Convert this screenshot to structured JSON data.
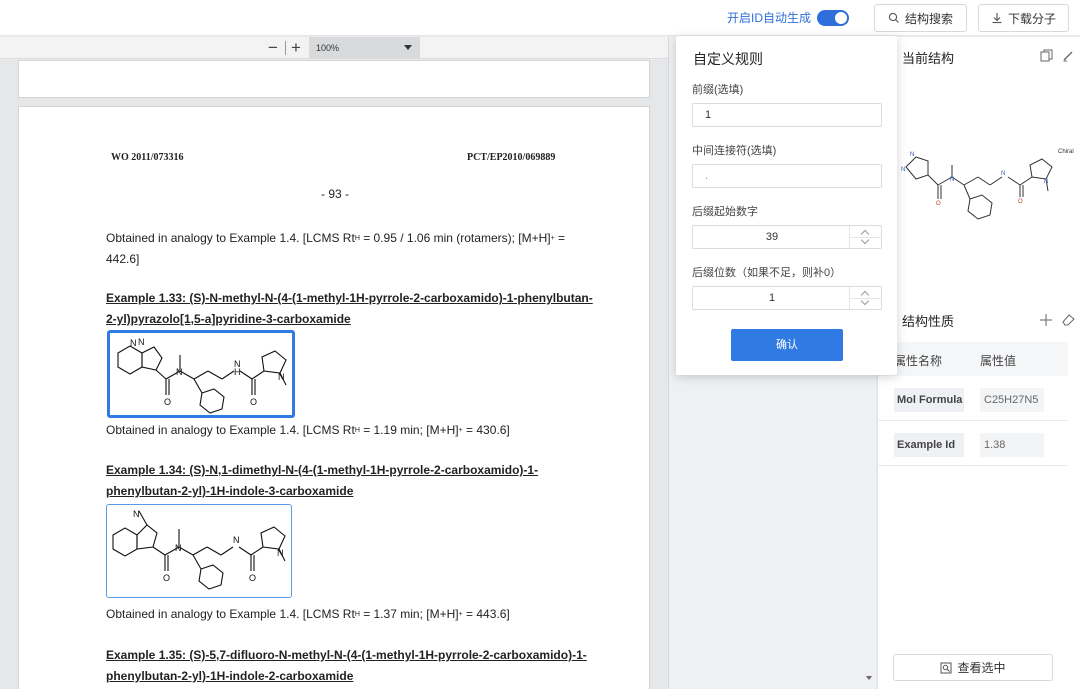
{
  "topbar": {
    "toggle_label": "开启ID自动生成",
    "toggle_on": true,
    "search_button": "结构搜索",
    "download_button": "下载分子"
  },
  "viewer": {
    "zoom_out": "−",
    "zoom_in": "+",
    "zoom_level": "100%",
    "page": {
      "header_left": "WO 2011/073316",
      "header_right": "PCT/EP2010/069889",
      "page_number": "- 93 -",
      "intro_text_1": "Obtained in analogy to Example 1.4. [LCMS Rt",
      "intro_sub": "H",
      "intro_text_2": " = 0.95 / 1.06 min (rotamers); [M+H]",
      "intro_sup": "+",
      "intro_text_3": " = 442.6]",
      "examples": [
        {
          "title": "Example 1.33: (S)-N-methyl-N-(4-(1-methyl-1H-pyrrole-2-carboxamido)-1-phenylbutan-2-yl)pyrazolo[1,5-a]pyridine-3-carboxamide",
          "result_1": "Obtained in analogy to Example 1.4. [LCMS Rt",
          "result_sub": "H",
          "result_2": " = 1.19 min; [M+H]",
          "result_sup": "+",
          "result_3": " = 430.6]"
        },
        {
          "title": "Example 1.34: (S)-N,1-dimethyl-N-(4-(1-methyl-1H-pyrrole-2-carboxamido)-1-phenylbutan-2-yl)-1H-indole-3-carboxamide",
          "result_1": "Obtained in analogy to Example 1.4. [LCMS Rt",
          "result_sub": "H",
          "result_2": " = 1.37 min; [M+H]",
          "result_sup": "+",
          "result_3": " = 443.6]"
        },
        {
          "title": "Example 1.35: (S)-5,7-difluoro-N-methyl-N-(4-(1-methyl-1H-pyrrole-2-carboxamido)-1-phenylbutan-2-yl)-1H-indole-2-carboxamide"
        }
      ]
    }
  },
  "popup": {
    "title": "自定义规则",
    "prefix_label": "前缀(选填)",
    "prefix_value": "1",
    "connector_label": "中间连接符(选填)",
    "connector_value": ".",
    "start_label": "后缀起始数字",
    "start_value": "39",
    "digits_label": "后缀位数（如果不足，则补0）",
    "digits_value": "1",
    "confirm": "确认"
  },
  "right_panel": {
    "current_structure": "当前结构",
    "chiral_label": "Chiral",
    "properties_title": "结构性质",
    "col_name": "属性名称",
    "col_value": "属性值",
    "rows": [
      {
        "key": "Mol Formula",
        "value": "C25H27N5"
      },
      {
        "key": "Example Id",
        "value": "1.38"
      }
    ],
    "view_selected": "查看选中"
  },
  "colors": {
    "accent": "#2f7be3",
    "toggle": "#2f6fdb"
  }
}
